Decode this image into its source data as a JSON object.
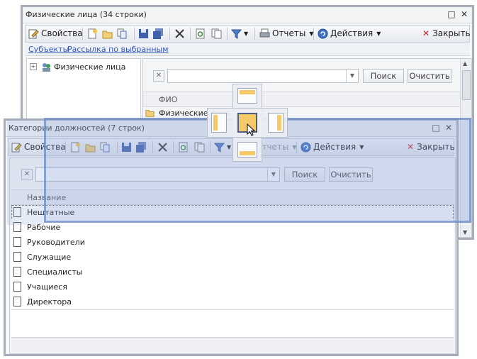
{
  "back_window": {
    "title": "Физические лица (34 строки)",
    "toolbar": {
      "properties": "Свойства",
      "reports": "Отчеты",
      "actions": "Действия",
      "close": "Закрыть"
    },
    "links": {
      "subjects": "Субъекты",
      "mailing": "Рассылка по выбранным"
    },
    "tree": {
      "root_label": "Физические лица"
    },
    "search": {
      "value": "",
      "search_btn": "Поиск",
      "clear_btn": "Очистить"
    },
    "grid": {
      "column": "ФИО",
      "rows": [
        "Физические лица"
      ]
    }
  },
  "front_window": {
    "title": "Категории должностей (7 строк)",
    "toolbar": {
      "properties": "Свойства",
      "reports": "Отчеты",
      "actions": "Действия",
      "close": "Закрыть"
    },
    "search": {
      "value": "",
      "search_btn": "Поиск",
      "clear_btn": "Очистить"
    },
    "grid": {
      "column": "Название",
      "rows": [
        "Нештатные",
        "Рабочие",
        "Руководители",
        "Служащие",
        "Специалисты",
        "Учащиеся",
        "Директора"
      ]
    }
  },
  "colors": {
    "dock_overlay": "#8aa3d6",
    "accent_close": "#c8242b",
    "highlight": "#f5c86a"
  }
}
